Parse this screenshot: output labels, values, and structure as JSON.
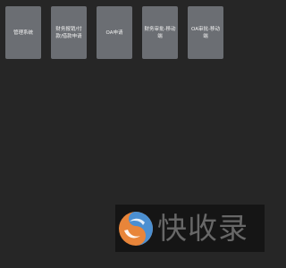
{
  "tiles": [
    {
      "label": "管理系统"
    },
    {
      "label": "财务报销/付款/借款申请"
    },
    {
      "label": "OA申请"
    },
    {
      "label": "财务审批-移动端"
    },
    {
      "label": "OA审批-移动端"
    }
  ],
  "watermark": {
    "text": "快收录",
    "logo_icon": "swirl-logo-icon",
    "colors": {
      "orange": "#e8853a",
      "blue": "#4b8fd1",
      "white": "#ffffff"
    }
  }
}
